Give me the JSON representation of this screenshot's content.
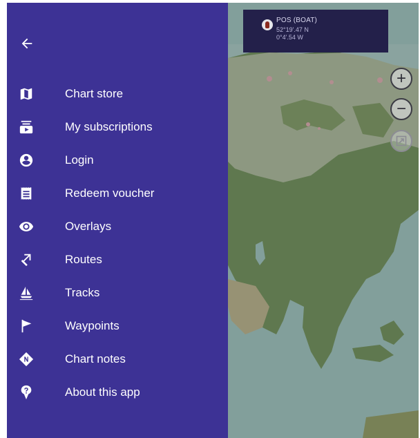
{
  "position_panel": {
    "title": "POS (BOAT)",
    "latitude": "52°19'.47 N",
    "longitude": "0°4'.54 W",
    "icon": "boat-icon"
  },
  "map_controls": {
    "zoom_in": "+",
    "zoom_out": "−",
    "third_button_icon": "resize-icon"
  },
  "drawer": {
    "background_color": "#3d3295",
    "back_icon": "arrow-left-icon",
    "items": [
      {
        "label": "Chart store",
        "icon": "map-icon"
      },
      {
        "label": "My subscriptions",
        "icon": "subscriptions-icon"
      },
      {
        "label": "Login",
        "icon": "account-circle-icon"
      },
      {
        "label": "Redeem voucher",
        "icon": "voucher-icon"
      },
      {
        "label": "Overlays",
        "icon": "eye-icon"
      },
      {
        "label": "Routes",
        "icon": "route-icon"
      },
      {
        "label": "Tracks",
        "icon": "sailboat-icon"
      },
      {
        "label": "Waypoints",
        "icon": "flag-icon"
      },
      {
        "label": "Chart notes",
        "icon": "note-marker-icon"
      },
      {
        "label": "About this app",
        "icon": "help-icon"
      }
    ]
  }
}
